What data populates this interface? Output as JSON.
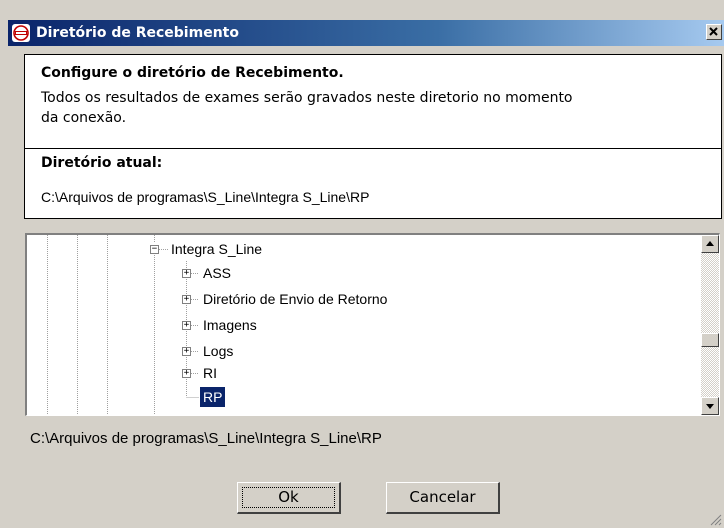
{
  "window": {
    "title": "Diretório de Recebimento",
    "icon": "app-logo-icon",
    "close_icon": "close-icon"
  },
  "info_panel": {
    "heading": "Configure o diretório de Recebimento.",
    "line1": "Todos os resultados de exames serão gravados neste diretorio no momento",
    "line2": "da conexão."
  },
  "current_dir_panel": {
    "heading": "Diretório atual:",
    "path": "C:\\Arquivos de programas\\S_Line\\Integra S_Line\\RP"
  },
  "tree": {
    "parent": {
      "label": "Integra S_Line",
      "expander": "−"
    },
    "children": [
      {
        "label": "ASS",
        "expander": "+"
      },
      {
        "label": "Diretório de Envio de Retorno",
        "expander": "+"
      },
      {
        "label": "Imagens",
        "expander": "+"
      },
      {
        "label": "Logs",
        "expander": "+"
      },
      {
        "label": "RI",
        "expander": "+"
      },
      {
        "label": "RP",
        "selected": true
      }
    ],
    "scroll_up_icon": "arrow-up-icon",
    "scroll_down_icon": "arrow-down-icon"
  },
  "selected_path": "C:\\Arquivos de programas\\S_Line\\Integra S_Line\\RP",
  "buttons": {
    "ok": "Ok",
    "cancel": "Cancelar"
  },
  "colors": {
    "title_bar": "#0a246a",
    "selection": "#0a246a",
    "face": "#d4d0c8"
  }
}
